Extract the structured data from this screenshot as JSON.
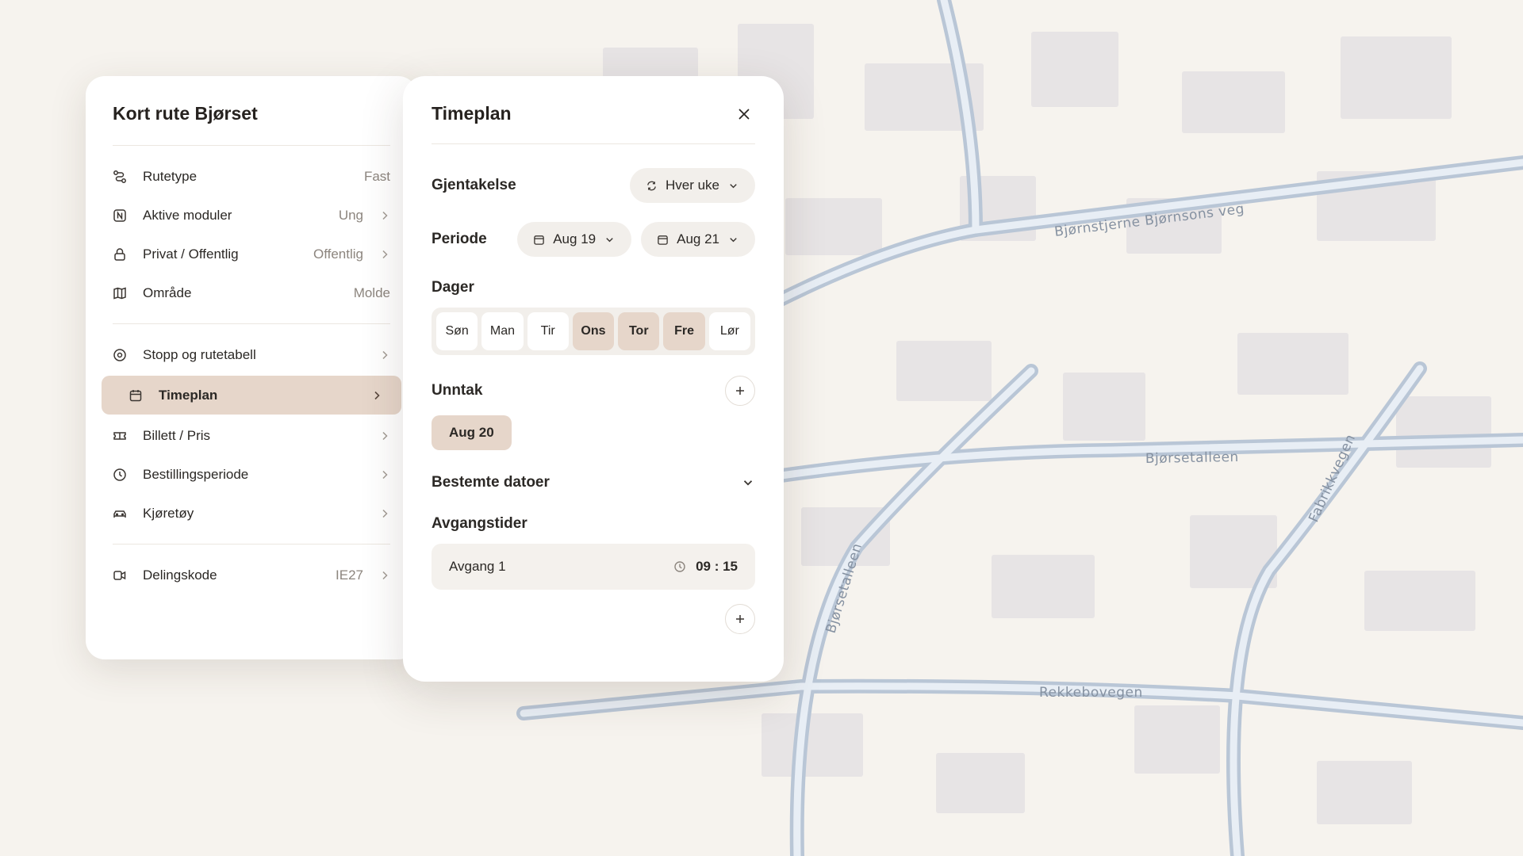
{
  "route_panel": {
    "title": "Kort rute Bjørset",
    "group1": [
      {
        "label": "Rutetype",
        "value": "Fast",
        "icon": "route-icon",
        "chevron": false
      },
      {
        "label": "Aktive moduler",
        "value": "Ung",
        "icon": "module-badge-icon",
        "chevron": true
      },
      {
        "label": "Privat / Offentlig",
        "value": "Offentlig",
        "icon": "lock-icon",
        "chevron": true
      },
      {
        "label": "Område",
        "value": "Molde",
        "icon": "map-icon",
        "chevron": false
      }
    ],
    "group2": [
      {
        "label": "Stopp og rutetabell",
        "value": "",
        "icon": "stop-icon",
        "chevron": true
      },
      {
        "label": "Timeplan",
        "value": "",
        "icon": "calendar-icon",
        "chevron": true,
        "active": true
      },
      {
        "label": "Billett / Pris",
        "value": "",
        "icon": "ticket-icon",
        "chevron": true
      },
      {
        "label": "Bestillingsperiode",
        "value": "",
        "icon": "clock-icon",
        "chevron": true
      },
      {
        "label": "Kjøretøy",
        "value": "",
        "icon": "car-icon",
        "chevron": true
      }
    ],
    "group3": [
      {
        "label": "Delingskode",
        "value": "IE27",
        "icon": "share-code-icon",
        "chevron": true
      }
    ]
  },
  "schedule_panel": {
    "title": "Timeplan",
    "repeat": {
      "label": "Gjentakelse",
      "value": "Hver uke"
    },
    "period": {
      "label": "Periode",
      "start": "Aug 19",
      "end": "Aug 21"
    },
    "days": {
      "label": "Dager",
      "items": [
        {
          "label": "Søn",
          "selected": false
        },
        {
          "label": "Man",
          "selected": false
        },
        {
          "label": "Tir",
          "selected": false
        },
        {
          "label": "Ons",
          "selected": true
        },
        {
          "label": "Tor",
          "selected": true
        },
        {
          "label": "Fre",
          "selected": true
        },
        {
          "label": "Lør",
          "selected": false
        }
      ]
    },
    "exceptions": {
      "label": "Unntak",
      "items": [
        "Aug 20"
      ]
    },
    "specific_dates": {
      "label": "Bestemte datoer"
    },
    "departures": {
      "label": "Avgangstider",
      "items": [
        {
          "label": "Avgang 1",
          "time": "09 : 15"
        }
      ]
    }
  },
  "map": {
    "streets": [
      "Bjørnstjerne Bjørnsons veg",
      "Bjørsetalleen",
      "Bjørsetalleen",
      "Fabrikkvegen",
      "Rekkebovegen"
    ]
  },
  "colors": {
    "background": "#f6f3ee",
    "accent": "#e6d6ca",
    "road": "#b9c6d6",
    "road_center": "#e8eef5",
    "building": "#e7e4e5"
  }
}
